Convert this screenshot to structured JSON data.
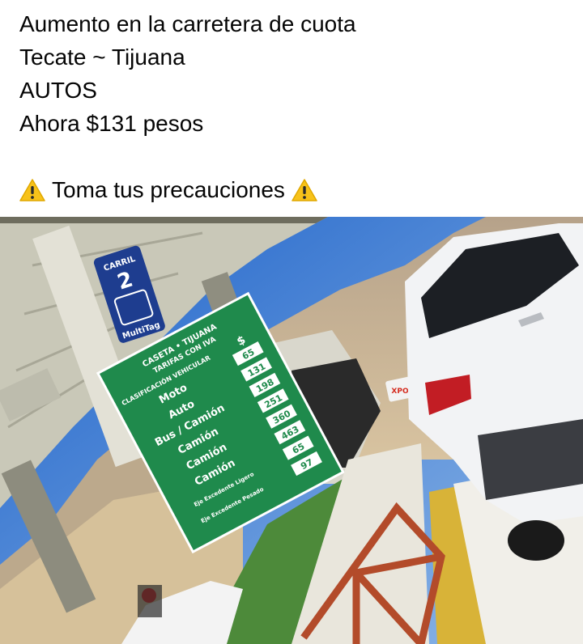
{
  "post": {
    "line1": "Aumento en la carretera de cuota",
    "line2": "Tecate ~ Tijuana",
    "line3": "AUTOS",
    "line4": "Ahora $131 pesos",
    "warning_text": "Toma tus precauciones"
  },
  "photo": {
    "lane_sign": {
      "label": "CARRIL",
      "number": "2",
      "tag": "MultiTag"
    },
    "toll_sign": {
      "header1": "CASETA • TIJUANA",
      "header2": "TARIFAS CON IVA",
      "class_header": "CLASIFICACIÓN VEHICULAR",
      "currency_symbol": "$",
      "rows": [
        {
          "label": "Moto",
          "price": "65"
        },
        {
          "label": "Auto",
          "price": "131"
        },
        {
          "label": "Bus / Camión",
          "price": "198"
        },
        {
          "label": "Camión",
          "price": "251"
        },
        {
          "label": "Camión",
          "price": "360"
        },
        {
          "label": "Camión",
          "price": "463"
        },
        {
          "label": "Eje Excedente Ligero",
          "price": "65"
        },
        {
          "label": "Eje Excedente Pesado",
          "price": "97"
        }
      ]
    },
    "store_sign": "XPO",
    "car_brand_icon": "chevrolet-bowtie-icon"
  },
  "colors": {
    "sky": "#4f86d6",
    "sign_green": "#1f8a4c",
    "warning_yellow": "#f7c21a"
  }
}
